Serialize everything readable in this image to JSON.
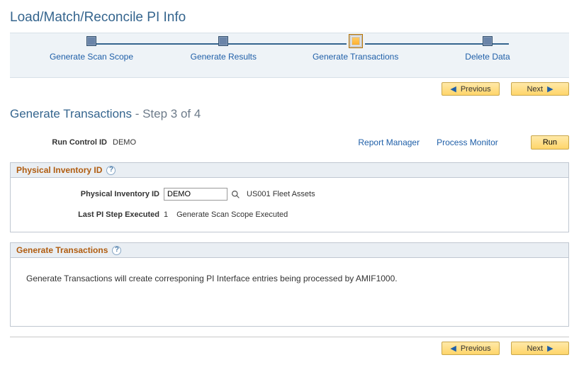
{
  "header": {
    "title": "Load/Match/Reconcile PI Info"
  },
  "wizard": {
    "steps": [
      {
        "label": "Generate Scan Scope"
      },
      {
        "label": "Generate Results"
      },
      {
        "label": "Generate Transactions"
      },
      {
        "label": "Delete Data"
      }
    ],
    "active_index": 2
  },
  "nav": {
    "previous": "Previous",
    "next": "Next"
  },
  "step_title": {
    "main": "Generate Transactions",
    "sub": " - Step 3 of 4"
  },
  "run_control": {
    "label": "Run Control ID",
    "value": "DEMO"
  },
  "links": {
    "report_manager": "Report Manager",
    "process_monitor": "Process Monitor",
    "run": "Run"
  },
  "group1": {
    "title": "Physical Inventory ID",
    "pi_label": "Physical Inventory ID",
    "pi_value": "DEMO",
    "pi_desc": "US001 Fleet Assets",
    "last_step_label": "Last PI Step Executed",
    "last_step_num": "1",
    "last_step_text": "Generate Scan Scope Executed"
  },
  "group2": {
    "title": "Generate Transactions",
    "body": "Generate Transactions will create corresponing PI Interface entries being processed by AMIF1000."
  }
}
